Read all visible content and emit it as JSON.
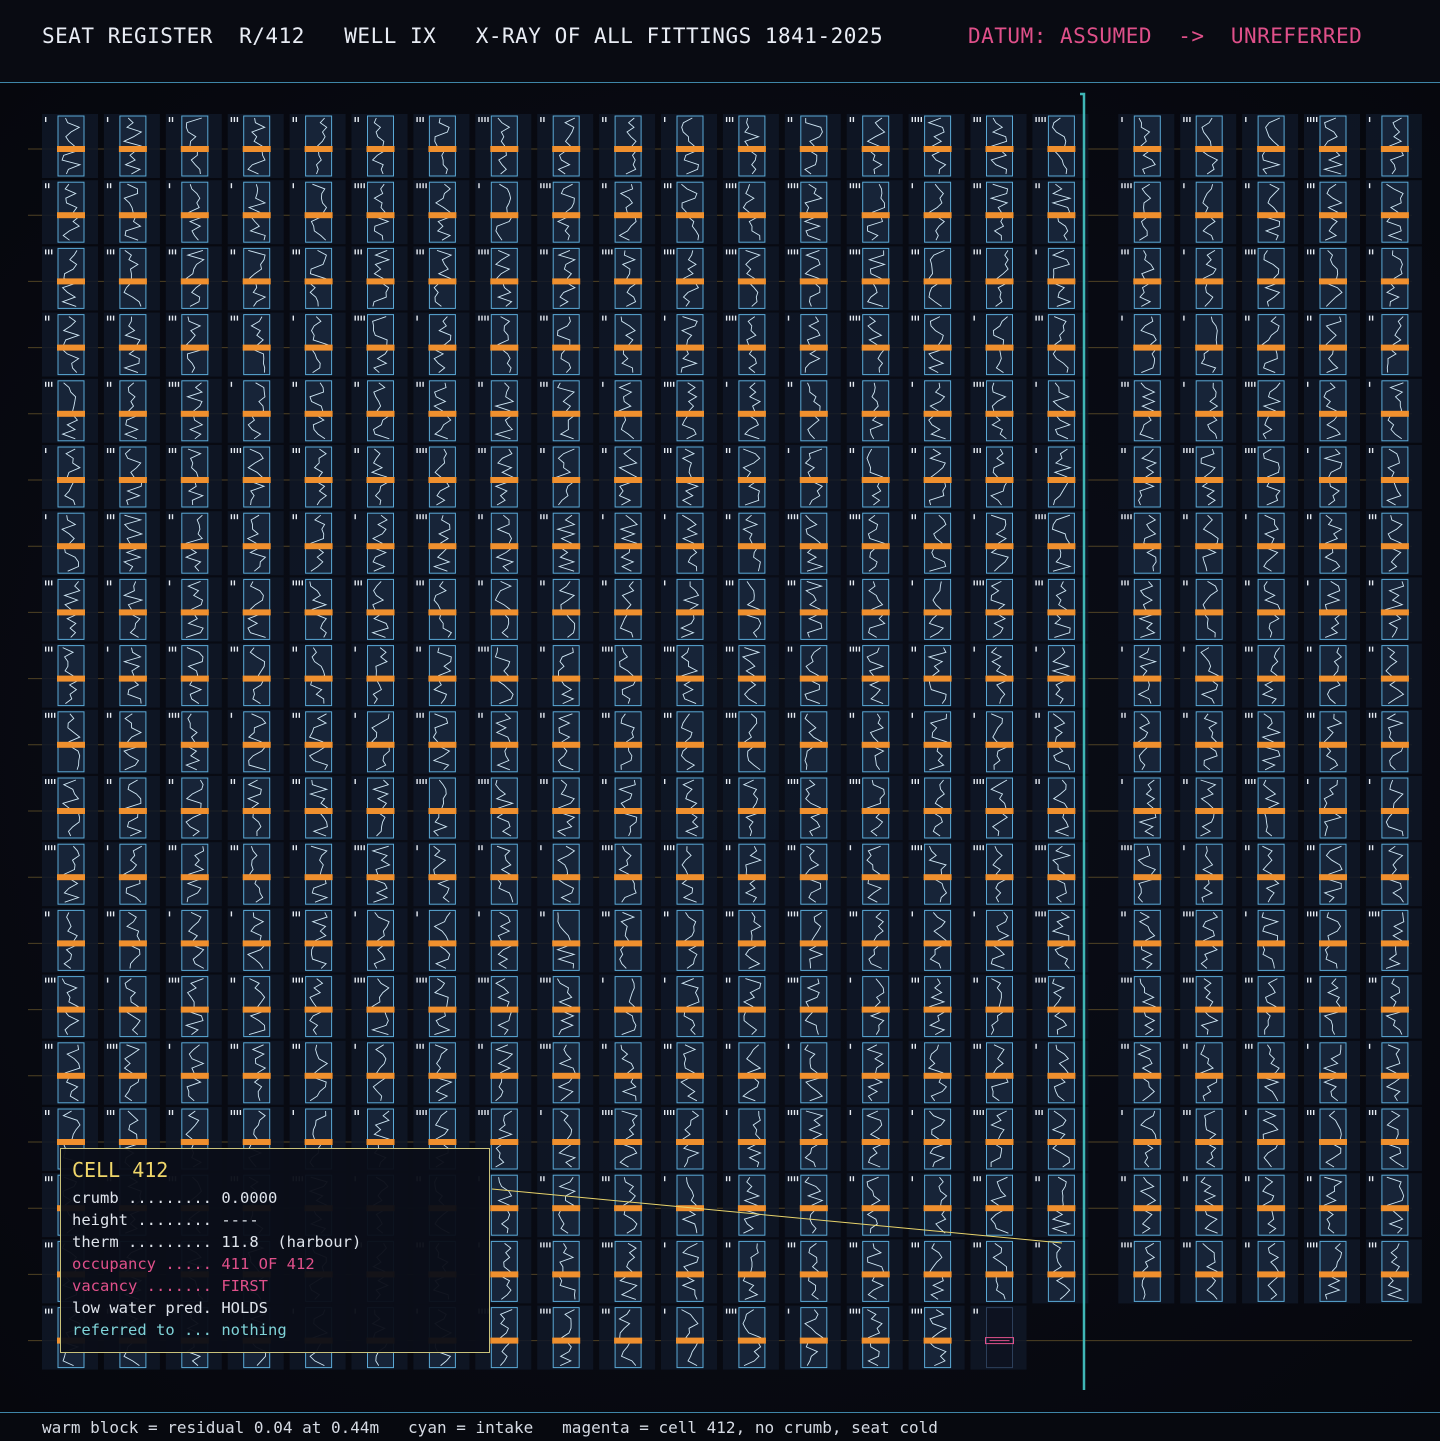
{
  "header": {
    "title": "SEAT REGISTER  R/412   WELL IX   X-RAY OF ALL FITTINGS 1841-2025",
    "datum": "DATUM: ASSUMED  ->  UNREFERRED"
  },
  "register": {
    "total_cells": 412,
    "occupied": 411,
    "cold_cell": 412,
    "colors": {
      "cell_bg": "#172438",
      "cell_frame": "#5aa9d6",
      "trace": "#cfe7f5",
      "warm_block": "#f0902e",
      "intake": "#3fb6b6",
      "magenta": "#e0508a",
      "callout": "#e8d36b"
    }
  },
  "panel": {
    "title": "CELL 412",
    "rows": [
      {
        "label": "crumb .........",
        "value": "0.0000",
        "tone": "normal"
      },
      {
        "label": "height ........",
        "value": "----",
        "tone": "normal"
      },
      {
        "label": "therm .........",
        "value": "11.8  (harbour)",
        "tone": "normal"
      },
      {
        "label": "occupancy .....",
        "value": "411 OF 412",
        "tone": "magenta"
      },
      {
        "label": "vacancy .......",
        "value": "FIRST",
        "tone": "magenta"
      },
      {
        "label": "low water pred.",
        "value": "HOLDS",
        "tone": "normal"
      },
      {
        "label": "referred to ...",
        "value": "nothing",
        "tone": "cyan"
      }
    ]
  },
  "footer": {
    "legend": "warm block = residual 0.04 at 0.44m   cyan = intake   magenta = cell 412, no crumb, seat cold"
  }
}
